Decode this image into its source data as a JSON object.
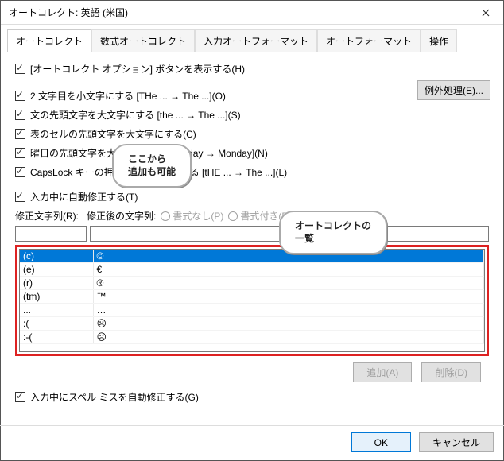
{
  "window": {
    "title": "オートコレクト: 英語 (米国)"
  },
  "tabs": [
    "オートコレクト",
    "数式オートコレクト",
    "入力オートフォーマット",
    "オートフォーマット",
    "操作"
  ],
  "activeTab": 0,
  "checkboxes": {
    "showBtn": "[オートコレクト オプション] ボタンを表示する(H)",
    "twoCaps": "2 文字目を小文字にする [THe ... → The ...](O)",
    "sentCap": "文の先頭文字を大文字にする [the ... → The ...](S)",
    "tableCap": "表のセルの先頭文字を大文字にする(C)",
    "dayCap": "曜日の先頭文字を大文字にする [monday → Monday](N)",
    "capslock": "CapsLock キーの押し間違いを修正する [tHE ... → The ...](L)",
    "autoRepl": "入力中に自動修正する(T)",
    "spellFix": "入力中にスペル ミスを自動修正する(G)"
  },
  "exBtn": "例外処理(E)...",
  "field": {
    "replace": "修正文字列(R):",
    "with": "修正後の文字列:",
    "radioPlain": "書式なし(P)",
    "radioFmt": "書式付き(F)"
  },
  "table": {
    "rows": [
      {
        "from": "(c)",
        "to": "©"
      },
      {
        "from": "(e)",
        "to": "€"
      },
      {
        "from": "(r)",
        "to": "®"
      },
      {
        "from": "(tm)",
        "to": "™"
      },
      {
        "from": "...",
        "to": "…"
      },
      {
        "from": ":(",
        "to": "☹"
      },
      {
        "from": ":-(",
        "to": "☹"
      }
    ],
    "selected": 0
  },
  "buttons": {
    "add": "追加(A)",
    "del": "削除(D)",
    "ok": "OK",
    "cancel": "キャンセル"
  },
  "callouts": {
    "c1a": "ここから",
    "c1b": "追加も可能",
    "c2a": "オートコレクトの",
    "c2b": "一覧"
  }
}
